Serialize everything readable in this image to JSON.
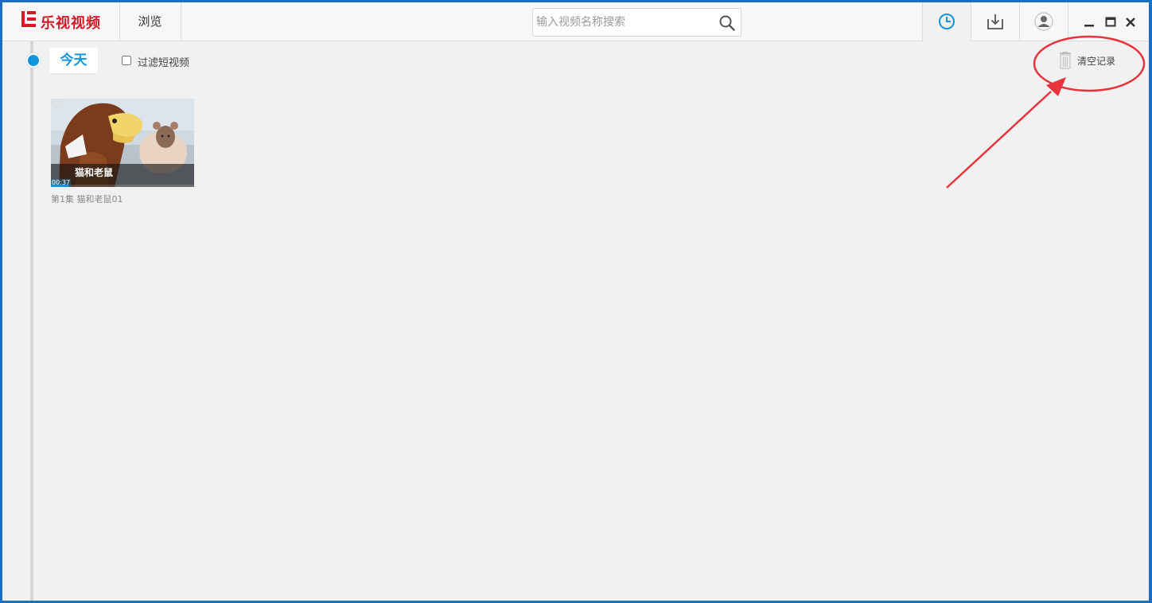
{
  "app": {
    "brand": "乐视视频",
    "brand_color": "#d41a28",
    "browse_tab": "浏览"
  },
  "search": {
    "placeholder": "输入视频名称搜索",
    "icon": "search-icon"
  },
  "nav": {
    "history_icon": "clock-icon",
    "download_icon": "download-icon",
    "user_icon": "user-icon",
    "active_color": "#1296db"
  },
  "window_controls": [
    "minimize",
    "maximize",
    "close"
  ],
  "history": {
    "date_label": "今天",
    "filter_label": "过滤短视频",
    "filter_checked": false,
    "clear_label": "清空记录",
    "items": [
      {
        "title": "猫和老鼠",
        "duration": "00:37",
        "progress": 0.12,
        "episode": "第1集 猫和老鼠01"
      }
    ]
  },
  "annotation_color": "#e8323c"
}
